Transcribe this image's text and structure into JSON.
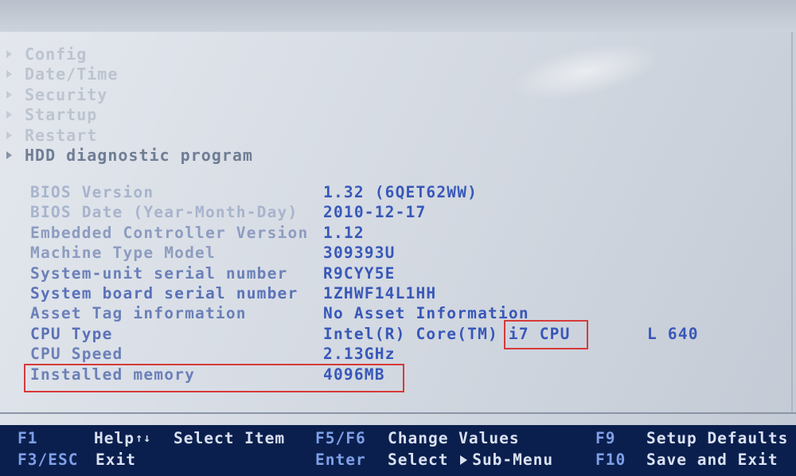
{
  "menu": [
    {
      "label": "Config"
    },
    {
      "label": "Date/Time"
    },
    {
      "label": "Security"
    },
    {
      "label": "Startup"
    },
    {
      "label": "Restart"
    },
    {
      "label": "HDD diagnostic program"
    }
  ],
  "info": [
    {
      "label": "BIOS Version",
      "value": "1.32  (6QET62WW)"
    },
    {
      "label": "BIOS Date (Year-Month-Day)",
      "value": "2010-12-17"
    },
    {
      "label": "Embedded Controller Version",
      "value": "1.12"
    },
    {
      "label": "Machine Type Model",
      "value": "309393U"
    },
    {
      "label": "System-unit serial number",
      "value": "R9CYY5E"
    },
    {
      "label": "System board serial number",
      "value": "1ZHWF14L1HH"
    },
    {
      "label": "Asset Tag information",
      "value": "No Asset Information"
    },
    {
      "label": "CPU Type",
      "value": "Intel(R) Core(TM) i7 CPU",
      "extra": "L 640"
    },
    {
      "label": "CPU Speed",
      "value": "2.13GHz"
    },
    {
      "label": "Installed memory",
      "value": "4096MB"
    }
  ],
  "footer": {
    "f1_key": "F1",
    "f1_desc": "Help",
    "updown_icon": "↑↓",
    "select_item": "Select Item",
    "esc_key": "F3/ESC",
    "esc_desc": "Exit",
    "f5f6_key": "F5/F6",
    "f5f6_desc": "Change Values",
    "enter_key": "Enter",
    "enter_desc_a": "Select",
    "enter_desc_b": "Sub-Menu",
    "f9_key": "F9",
    "f9_desc": "Setup Defaults",
    "f10_key": "F10",
    "f10_desc": "Save and Exit"
  },
  "colors": {
    "highlight": "#d63a3a",
    "value": "#3858b8",
    "footer_bg": "#0b1f4e"
  }
}
